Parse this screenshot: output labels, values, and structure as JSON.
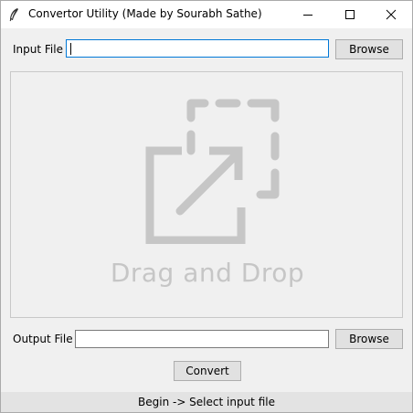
{
  "window": {
    "title": "Convertor Utility (Made by Sourabh Sathe)",
    "app_icon": "feather-icon",
    "controls": {
      "minimize": "minimize-icon",
      "maximize": "maximize-icon",
      "close": "close-icon"
    }
  },
  "input_row": {
    "label": "Input File",
    "value": "",
    "browse_label": "Browse"
  },
  "dropzone": {
    "text": "Drag and Drop",
    "icon": "drag-drop-icon",
    "graphic_color": "#c6c6c6"
  },
  "output_row": {
    "label": "Output File",
    "value": "",
    "browse_label": "Browse"
  },
  "convert_label": "Convert",
  "status": "Begin -> Select input file",
  "colors": {
    "focus_border": "#0078d7",
    "button_bg": "#e1e1e1",
    "window_bg": "#f0f0f0"
  }
}
